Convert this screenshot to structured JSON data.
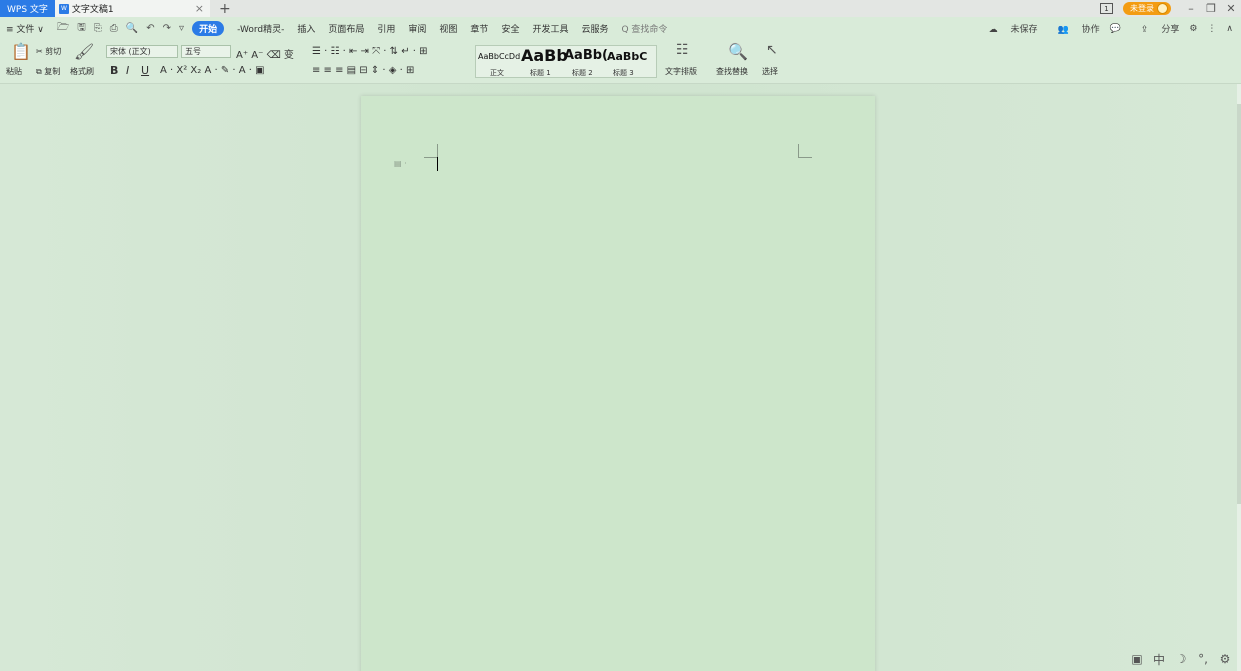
{
  "titlebar": {
    "app_tab": "WPS 文字",
    "doc_tab": "文字文稿1",
    "doc_icon": "W",
    "close": "×",
    "add": "+",
    "box_label": "1",
    "login": "未登录"
  },
  "menubar": {
    "file": "≡ 文件 ∨",
    "items": [
      "开始",
      "-Word精灵-",
      "插入",
      "页面布局",
      "引用",
      "审阅",
      "视图",
      "章节",
      "安全",
      "开发工具",
      "云服务"
    ],
    "search": "Q 查找命令",
    "right": {
      "unsaved": "未保存",
      "collab": "协作",
      "share": "分享"
    }
  },
  "ribbon": {
    "paste": "粘贴",
    "cut": "剪切",
    "copy": "复制",
    "format_painter": "格式刷",
    "font_name": "宋体 (正文)",
    "font_size": "五号",
    "styles": [
      {
        "sample": "AaBbCcDd",
        "label": "正文"
      },
      {
        "sample": "AaBb",
        "label": "标题 1"
      },
      {
        "sample": "AaBb(",
        "label": "标题 2"
      },
      {
        "sample": "AaBbC",
        "label": "标题 3"
      }
    ],
    "text_layout": "文字排版",
    "find_replace": "查找替换",
    "select": "选择"
  },
  "status": {
    "input_lang": "中"
  }
}
